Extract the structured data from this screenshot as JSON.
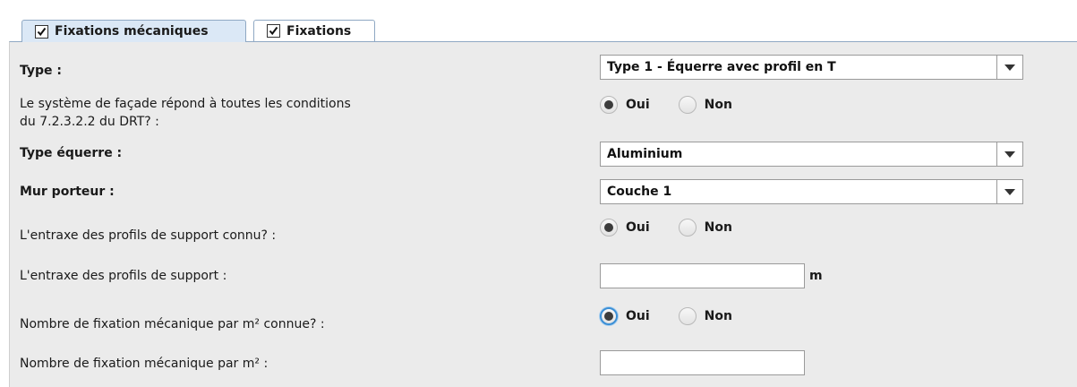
{
  "tabs": [
    {
      "label": "Fixations mécaniques",
      "checked": true,
      "active": true
    },
    {
      "label": "Fixations",
      "checked": true,
      "active": false
    }
  ],
  "form": {
    "type": {
      "label": "Type :",
      "value": "Type 1 - Équerre avec profil en T"
    },
    "conditions": {
      "label_line1": "Le système de façade répond à toutes les conditions",
      "label_line2": "du 7.2.3.2.2 du DRT? :",
      "yes": "Oui",
      "no": "Non",
      "selected": "Oui"
    },
    "type_equerre": {
      "label": "Type équerre :",
      "value": "Aluminium"
    },
    "mur_porteur": {
      "label": "Mur porteur :",
      "value": "Couche 1"
    },
    "entraxe_connu": {
      "label": "L'entraxe des profils de support connu? :",
      "yes": "Oui",
      "no": "Non",
      "selected": "Oui"
    },
    "entraxe": {
      "label": "L'entraxe des profils de support :",
      "value": "",
      "unit": "m"
    },
    "nb_fix_connue": {
      "label": "Nombre de fixation mécanique par m² connue? :",
      "yes": "Oui",
      "no": "Non",
      "selected": "Oui"
    },
    "nb_fix": {
      "label": "Nombre de fixation mécanique par m² :",
      "value": ""
    }
  },
  "colors": {
    "tab_active_bg": "#dbe8f6",
    "panel_bg": "#ebebeb",
    "focus_ring": "#3b8fd6"
  }
}
